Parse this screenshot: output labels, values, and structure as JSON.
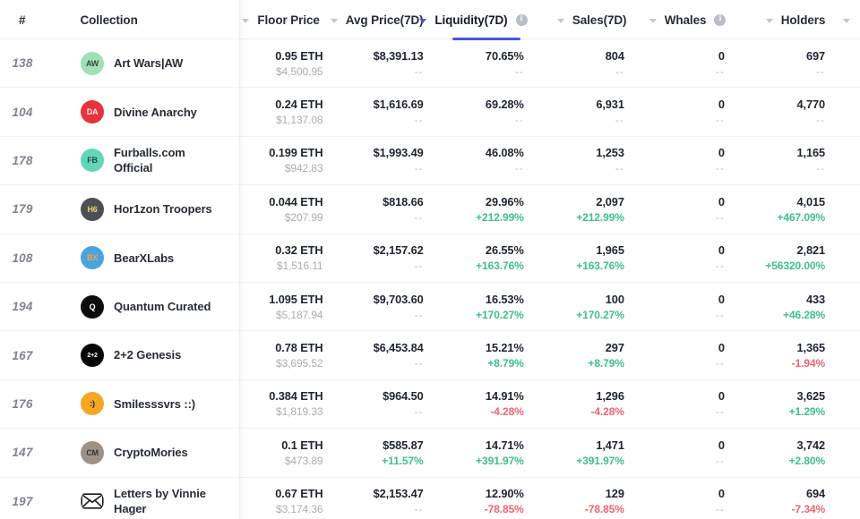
{
  "header": {
    "rank_label": "#",
    "collection_label": "Collection",
    "columns": [
      {
        "label": "Floor Price",
        "sorted": false,
        "has_info": false
      },
      {
        "label": "Avg Price(7D)",
        "sorted": false,
        "has_info": false
      },
      {
        "label": "Liquidity(7D)",
        "sorted": true,
        "has_info": true
      },
      {
        "label": "Sales(7D)",
        "sorted": false,
        "has_info": false
      },
      {
        "label": "Whales",
        "sorted": false,
        "has_info": true
      },
      {
        "label": "Holders",
        "sorted": false,
        "has_info": false
      }
    ],
    "info_glyph": "i",
    "sort_direction": "desc",
    "accent_color": "#4a55e0",
    "up_color": "#3fbf87",
    "down_color": "#ef6372",
    "muted_color": "#a9adb6"
  },
  "rows": [
    {
      "rank": "138",
      "name": "Art Wars|AW",
      "avatar": {
        "name": "art-wars-avatar",
        "bg": "#9fe0b4",
        "fg": "#3c4a3f",
        "initials": "AW"
      },
      "floor_price": {
        "main": "0.95 ETH",
        "sub": "$4,500.95",
        "sub_state": "neutral"
      },
      "avg_price": {
        "main": "$8,391.13",
        "sub": "--",
        "sub_state": "muted"
      },
      "liquidity": {
        "main": "70.65%",
        "sub": "--",
        "sub_state": "muted"
      },
      "sales": {
        "main": "804",
        "sub": "--",
        "sub_state": "muted"
      },
      "whales": {
        "main": "0",
        "sub": "--",
        "sub_state": "muted"
      },
      "holders": {
        "main": "697",
        "sub": "--",
        "sub_state": "muted"
      }
    },
    {
      "rank": "104",
      "name": "Divine Anarchy",
      "avatar": {
        "name": "divine-anarchy-avatar",
        "bg": "#e8323c",
        "fg": "#ffe9ea",
        "initials": "DA"
      },
      "floor_price": {
        "main": "0.24 ETH",
        "sub": "$1,137.08",
        "sub_state": "neutral"
      },
      "avg_price": {
        "main": "$1,616.69",
        "sub": "--",
        "sub_state": "muted"
      },
      "liquidity": {
        "main": "69.28%",
        "sub": "--",
        "sub_state": "muted"
      },
      "sales": {
        "main": "6,931",
        "sub": "--",
        "sub_state": "muted"
      },
      "whales": {
        "main": "0",
        "sub": "--",
        "sub_state": "muted"
      },
      "holders": {
        "main": "4,770",
        "sub": "--",
        "sub_state": "muted"
      }
    },
    {
      "rank": "178",
      "name": "Furballs.com Official",
      "avatar": {
        "name": "furballs-avatar",
        "bg": "#63d6b8",
        "fg": "#1d4f42",
        "initials": "FB"
      },
      "floor_price": {
        "main": "0.199 ETH",
        "sub": "$942.83",
        "sub_state": "neutral"
      },
      "avg_price": {
        "main": "$1,993.49",
        "sub": "--",
        "sub_state": "muted"
      },
      "liquidity": {
        "main": "46.08%",
        "sub": "--",
        "sub_state": "muted"
      },
      "sales": {
        "main": "1,253",
        "sub": "--",
        "sub_state": "muted"
      },
      "whales": {
        "main": "0",
        "sub": "--",
        "sub_state": "muted"
      },
      "holders": {
        "main": "1,165",
        "sub": "--",
        "sub_state": "muted"
      }
    },
    {
      "rank": "179",
      "name": "Hor1zon Troopers",
      "avatar": {
        "name": "hor1zon-troopers-avatar",
        "bg": "#4c5056",
        "fg": "#e8d45a",
        "initials": "H6"
      },
      "floor_price": {
        "main": "0.044 ETH",
        "sub": "$207.99",
        "sub_state": "neutral"
      },
      "avg_price": {
        "main": "$818.66",
        "sub": "--",
        "sub_state": "muted"
      },
      "liquidity": {
        "main": "29.96%",
        "sub": "+212.99%",
        "sub_state": "up"
      },
      "sales": {
        "main": "2,097",
        "sub": "+212.99%",
        "sub_state": "up"
      },
      "whales": {
        "main": "0",
        "sub": "--",
        "sub_state": "muted"
      },
      "holders": {
        "main": "4,015",
        "sub": "+467.09%",
        "sub_state": "up"
      }
    },
    {
      "rank": "108",
      "name": "BearXLabs",
      "avatar": {
        "name": "bearxlabs-avatar",
        "bg": "#4ba3dd",
        "fg": "#f0a65a",
        "initials": "BX"
      },
      "floor_price": {
        "main": "0.32 ETH",
        "sub": "$1,516.11",
        "sub_state": "neutral"
      },
      "avg_price": {
        "main": "$2,157.62",
        "sub": "--",
        "sub_state": "muted"
      },
      "liquidity": {
        "main": "26.55%",
        "sub": "+163.76%",
        "sub_state": "up"
      },
      "sales": {
        "main": "1,965",
        "sub": "+163.76%",
        "sub_state": "up"
      },
      "whales": {
        "main": "0",
        "sub": "--",
        "sub_state": "muted"
      },
      "holders": {
        "main": "2,821",
        "sub": "+56320.00%",
        "sub_state": "up"
      }
    },
    {
      "rank": "194",
      "name": "Quantum Curated",
      "avatar": {
        "name": "quantum-curated-avatar",
        "bg": "#0c0c0c",
        "fg": "#ffffff",
        "initials": "Q"
      },
      "floor_price": {
        "main": "1.095 ETH",
        "sub": "$5,187.94",
        "sub_state": "neutral"
      },
      "avg_price": {
        "main": "$9,703.60",
        "sub": "--",
        "sub_state": "muted"
      },
      "liquidity": {
        "main": "16.53%",
        "sub": "+170.27%",
        "sub_state": "up"
      },
      "sales": {
        "main": "100",
        "sub": "+170.27%",
        "sub_state": "up"
      },
      "whales": {
        "main": "0",
        "sub": "--",
        "sub_state": "muted"
      },
      "holders": {
        "main": "433",
        "sub": "+46.28%",
        "sub_state": "up"
      }
    },
    {
      "rank": "167",
      "name": "2+2 Genesis",
      "avatar": {
        "name": "2plus2-genesis-avatar",
        "bg": "#070707",
        "fg": "#ffffff",
        "initials": "2+2"
      },
      "floor_price": {
        "main": "0.78 ETH",
        "sub": "$3,695.52",
        "sub_state": "neutral"
      },
      "avg_price": {
        "main": "$6,453.84",
        "sub": "--",
        "sub_state": "muted"
      },
      "liquidity": {
        "main": "15.21%",
        "sub": "+8.79%",
        "sub_state": "up"
      },
      "sales": {
        "main": "297",
        "sub": "+8.79%",
        "sub_state": "up"
      },
      "whales": {
        "main": "0",
        "sub": "--",
        "sub_state": "muted"
      },
      "holders": {
        "main": "1,365",
        "sub": "-1.94%",
        "sub_state": "down"
      }
    },
    {
      "rank": "176",
      "name": "Smilesssvrs ::)",
      "avatar": {
        "name": "smilesssvrs-avatar",
        "bg": "#f5a623",
        "fg": "#1a1a1a",
        "initials": ":)"
      },
      "floor_price": {
        "main": "0.384 ETH",
        "sub": "$1,819.33",
        "sub_state": "neutral"
      },
      "avg_price": {
        "main": "$964.50",
        "sub": "--",
        "sub_state": "muted"
      },
      "liquidity": {
        "main": "14.91%",
        "sub": "-4.28%",
        "sub_state": "down"
      },
      "sales": {
        "main": "1,296",
        "sub": "-4.28%",
        "sub_state": "down"
      },
      "whales": {
        "main": "0",
        "sub": "--",
        "sub_state": "muted"
      },
      "holders": {
        "main": "3,625",
        "sub": "+1.29%",
        "sub_state": "up"
      }
    },
    {
      "rank": "147",
      "name": "CryptoMories",
      "avatar": {
        "name": "cryptomories-avatar",
        "bg": "#9d9188",
        "fg": "#3a3530",
        "initials": "CM"
      },
      "floor_price": {
        "main": "0.1 ETH",
        "sub": "$473.89",
        "sub_state": "neutral"
      },
      "avg_price": {
        "main": "$585.87",
        "sub": "+11.57%",
        "sub_state": "up"
      },
      "liquidity": {
        "main": "14.71%",
        "sub": "+391.97%",
        "sub_state": "up"
      },
      "sales": {
        "main": "1,471",
        "sub": "+391.97%",
        "sub_state": "up"
      },
      "whales": {
        "main": "0",
        "sub": "--",
        "sub_state": "muted"
      },
      "holders": {
        "main": "3,742",
        "sub": "+2.80%",
        "sub_state": "up"
      }
    },
    {
      "rank": "197",
      "name": "Letters by Vinnie Hager",
      "avatar": {
        "name": "letters-envelope-avatar",
        "bg": "#ffffff",
        "fg": "#1a1a1a",
        "initials": "",
        "shape": "envelope"
      },
      "floor_price": {
        "main": "0.67 ETH",
        "sub": "$3,174.36",
        "sub_state": "neutral"
      },
      "avg_price": {
        "main": "$2,153.47",
        "sub": "--",
        "sub_state": "muted"
      },
      "liquidity": {
        "main": "12.90%",
        "sub": "-78.85%",
        "sub_state": "down"
      },
      "sales": {
        "main": "129",
        "sub": "-78.85%",
        "sub_state": "down"
      },
      "whales": {
        "main": "0",
        "sub": "--",
        "sub_state": "muted"
      },
      "holders": {
        "main": "694",
        "sub": "-7.34%",
        "sub_state": "down"
      }
    }
  ]
}
